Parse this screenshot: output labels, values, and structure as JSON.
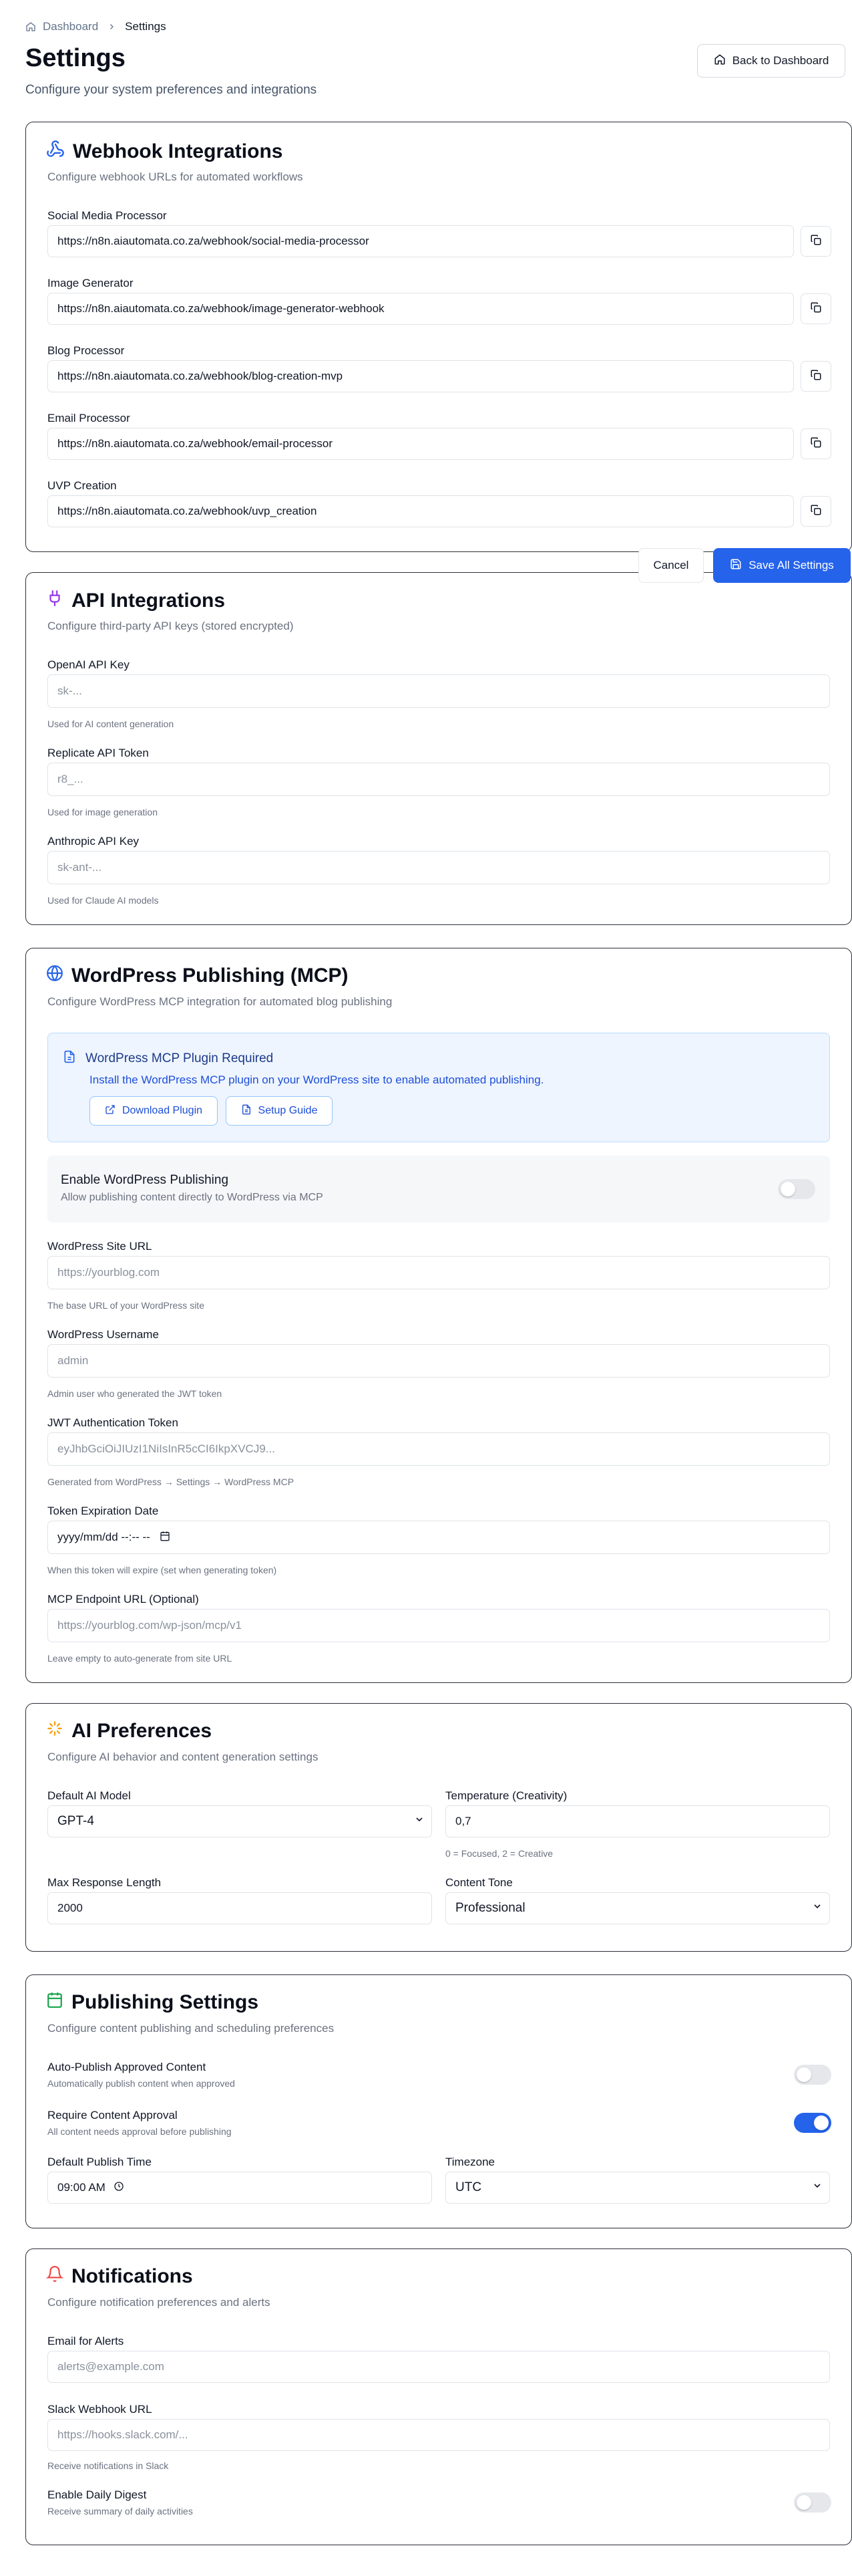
{
  "breadcrumb": {
    "home": "Dashboard",
    "current": "Settings"
  },
  "header": {
    "title": "Settings",
    "subtitle": "Configure your system preferences and integrations",
    "back_label": "Back to Dashboard"
  },
  "actions": {
    "cancel": "Cancel",
    "save": "Save All Settings"
  },
  "webhooks": {
    "title": "Webhook Integrations",
    "subtitle": "Configure webhook URLs for automated workflows",
    "items": [
      {
        "label": "Social Media Processor",
        "value": "https://n8n.aiautomata.co.za/webhook/social-media-processor"
      },
      {
        "label": "Image Generator",
        "value": "https://n8n.aiautomata.co.za/webhook/image-generator-webhook"
      },
      {
        "label": "Blog Processor",
        "value": "https://n8n.aiautomata.co.za/webhook/blog-creation-mvp"
      },
      {
        "label": "Email Processor",
        "value": "https://n8n.aiautomata.co.za/webhook/email-processor"
      },
      {
        "label": "UVP Creation",
        "value": "https://n8n.aiautomata.co.za/webhook/uvp_creation"
      }
    ]
  },
  "api": {
    "title": "API Integrations",
    "subtitle": "Configure third-party API keys (stored encrypted)",
    "items": [
      {
        "label": "OpenAI API Key",
        "placeholder": "sk-...",
        "help": "Used for AI content generation"
      },
      {
        "label": "Replicate API Token",
        "placeholder": "r8_...",
        "help": "Used for image generation"
      },
      {
        "label": "Anthropic API Key",
        "placeholder": "sk-ant-...",
        "help": "Used for Claude AI models"
      }
    ]
  },
  "wordpress": {
    "title": "WordPress Publishing (MCP)",
    "subtitle": "Configure WordPress MCP integration for automated blog publishing",
    "notice_title": "WordPress MCP Plugin Required",
    "notice_text": "Install the WordPress MCP plugin on your WordPress site to enable automated publishing.",
    "download_label": "Download Plugin",
    "guide_label": "Setup Guide",
    "enable_title": "Enable WordPress Publishing",
    "enable_sub": "Allow publishing content directly to WordPress via MCP",
    "enable_on": false,
    "site_url": {
      "label": "WordPress Site URL",
      "placeholder": "https://yourblog.com",
      "help": "The base URL of your WordPress site"
    },
    "username": {
      "label": "WordPress Username",
      "placeholder": "admin",
      "help": "Admin user who generated the JWT token"
    },
    "jwt": {
      "label": "JWT Authentication Token",
      "placeholder": "eyJhbGciOiJIUzI1NiIsInR5cCI6IkpXVCJ9...",
      "help": "Generated from WordPress → Settings → WordPress MCP"
    },
    "expiry": {
      "label": "Token Expiration Date",
      "value": "yyyy/mm/dd --:-- --",
      "help": "When this token will expire (set when generating token)"
    },
    "endpoint": {
      "label": "MCP Endpoint URL (Optional)",
      "placeholder": "https://yourblog.com/wp-json/mcp/v1",
      "help": "Leave empty to auto-generate from site URL"
    }
  },
  "ai": {
    "title": "AI Preferences",
    "subtitle": "Configure AI behavior and content generation settings",
    "model_label": "Default AI Model",
    "model_value": "GPT-4",
    "temp_label": "Temperature (Creativity)",
    "temp_value": "0,7",
    "temp_help": "0 = Focused, 2 = Creative",
    "maxlen_label": "Max Response Length",
    "maxlen_value": "2000",
    "tone_label": "Content Tone",
    "tone_value": "Professional"
  },
  "publishing": {
    "title": "Publishing Settings",
    "subtitle": "Configure content publishing and scheduling preferences",
    "auto_title": "Auto-Publish Approved Content",
    "auto_sub": "Automatically publish content when approved",
    "auto_on": false,
    "approval_title": "Require Content Approval",
    "approval_sub": "All content needs approval before publishing",
    "approval_on": true,
    "time_label": "Default Publish Time",
    "time_value": "09:00 AM",
    "tz_label": "Timezone",
    "tz_value": "UTC"
  },
  "notifications": {
    "title": "Notifications",
    "subtitle": "Configure notification preferences and alerts",
    "email_label": "Email for Alerts",
    "email_placeholder": "alerts@example.com",
    "slack_label": "Slack Webhook URL",
    "slack_placeholder": "https://hooks.slack.com/...",
    "slack_help": "Receive notifications in Slack",
    "digest_title": "Enable Daily Digest",
    "digest_sub": "Receive summary of daily activities",
    "digest_on": false
  },
  "colors": {
    "accent": "#2563eb",
    "webhook_icon": "#2563eb",
    "api_icon": "#9333ea",
    "ai_icon": "#f59e0b",
    "publish_icon": "#16a34a",
    "bell_icon": "#ef4444"
  },
  "icons": [
    "home-icon",
    "chevron-right-icon",
    "webhook-icon",
    "copy-icon",
    "plug-icon",
    "globe-icon",
    "file-icon",
    "external-link-icon",
    "sparkles-icon",
    "calendar-icon",
    "clock-icon",
    "bell-icon",
    "save-icon",
    "chevron-down-icon"
  ]
}
